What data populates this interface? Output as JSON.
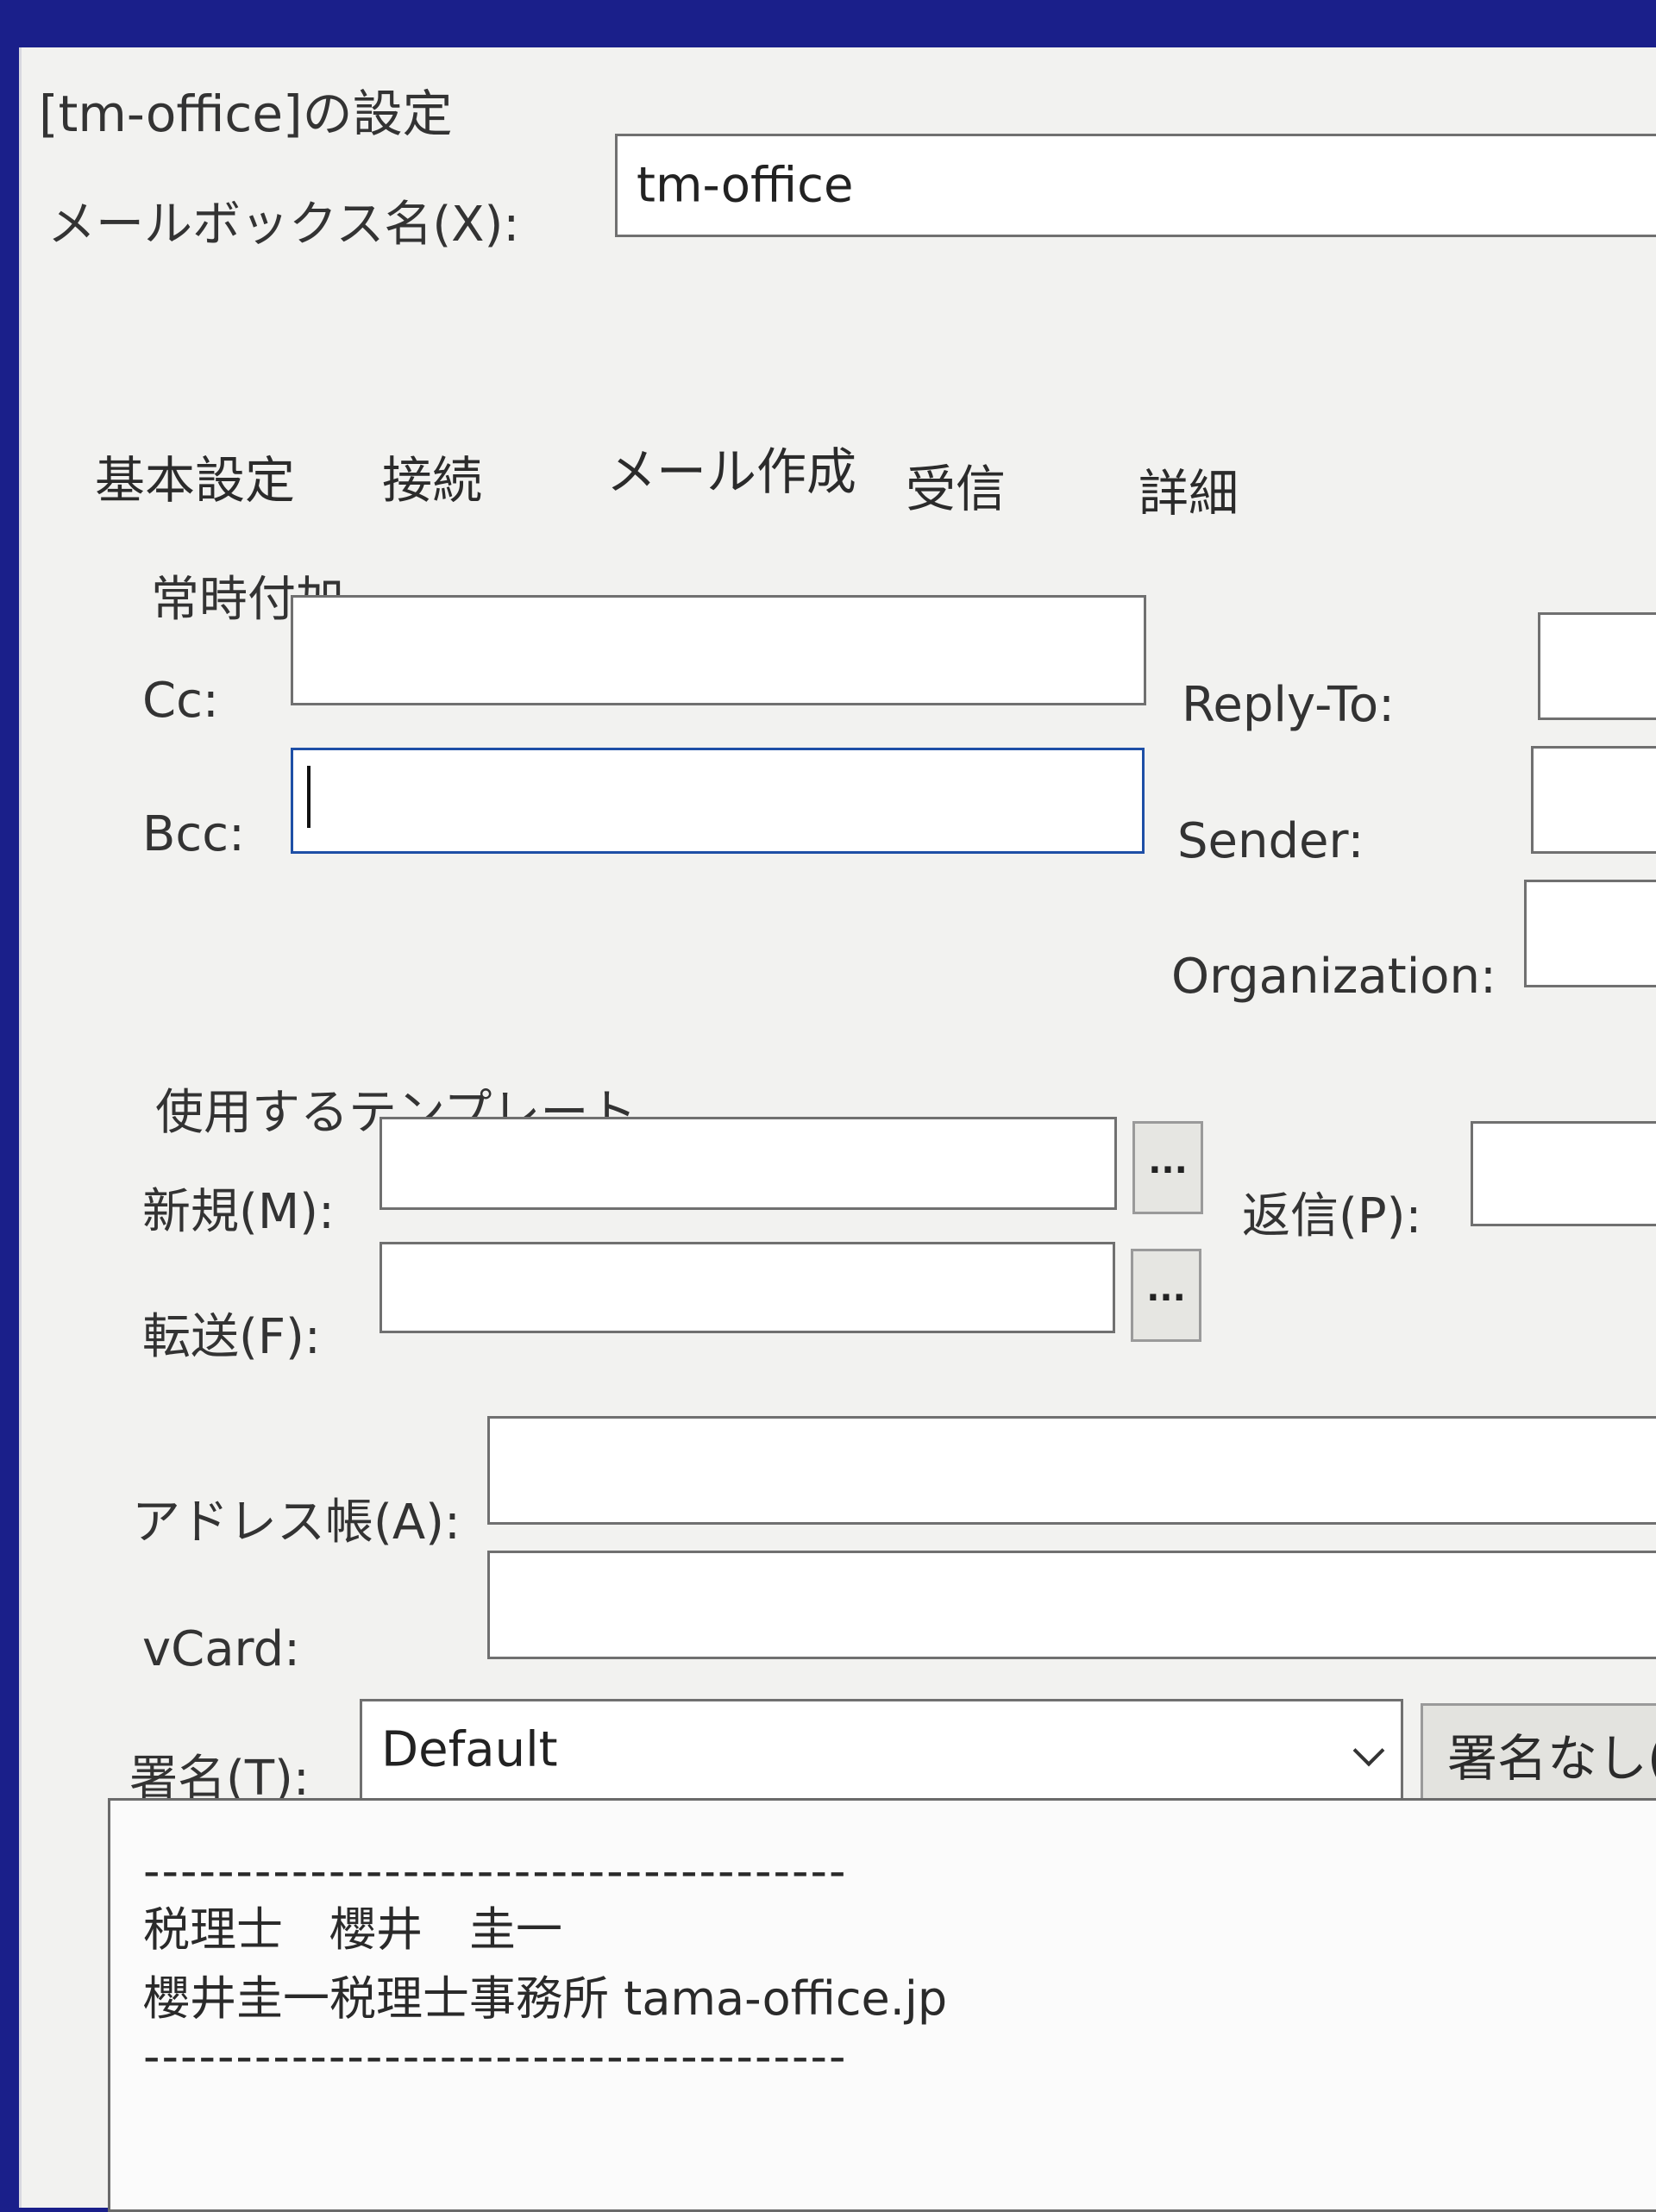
{
  "window": {
    "title": "[tm-office]の設定"
  },
  "mailbox": {
    "label": "メールボックス名(X):",
    "value": "tm-office"
  },
  "tabs": [
    {
      "label": "基本設定"
    },
    {
      "label": "接続"
    },
    {
      "label": "メール作成"
    },
    {
      "label": "受信"
    },
    {
      "label": "詳細"
    }
  ],
  "always_add": {
    "heading": "常時付加",
    "cc_label": "Cc:",
    "cc_value": "",
    "bcc_label": "Bcc:",
    "bcc_value": "",
    "reply_to_label": "Reply-To:",
    "sender_label": "Sender:",
    "organization_label": "Organization:"
  },
  "templates": {
    "heading": "使用するテンプレート",
    "new_label": "新規(M):",
    "new_value": "",
    "reply_label": "返信(P):",
    "forward_label": "転送(F):",
    "forward_value": "",
    "browse_label": "..."
  },
  "address_book": {
    "label": "アドレス帳(A):",
    "value": ""
  },
  "vcard": {
    "label": "vCard:",
    "value": ""
  },
  "signature": {
    "label": "署名(T):",
    "selected": "Default",
    "no_signature_button": "署名なし(",
    "lines": [
      "--------------------------------------",
      "税理士　櫻井　圭一",
      "櫻井圭一税理士事務所 tama-office.jp",
      "--------------------------------------"
    ]
  },
  "colors": {
    "background": "#1a1f8a",
    "dialog": "#f2f2f0",
    "focus_border": "#1e4fa6"
  }
}
